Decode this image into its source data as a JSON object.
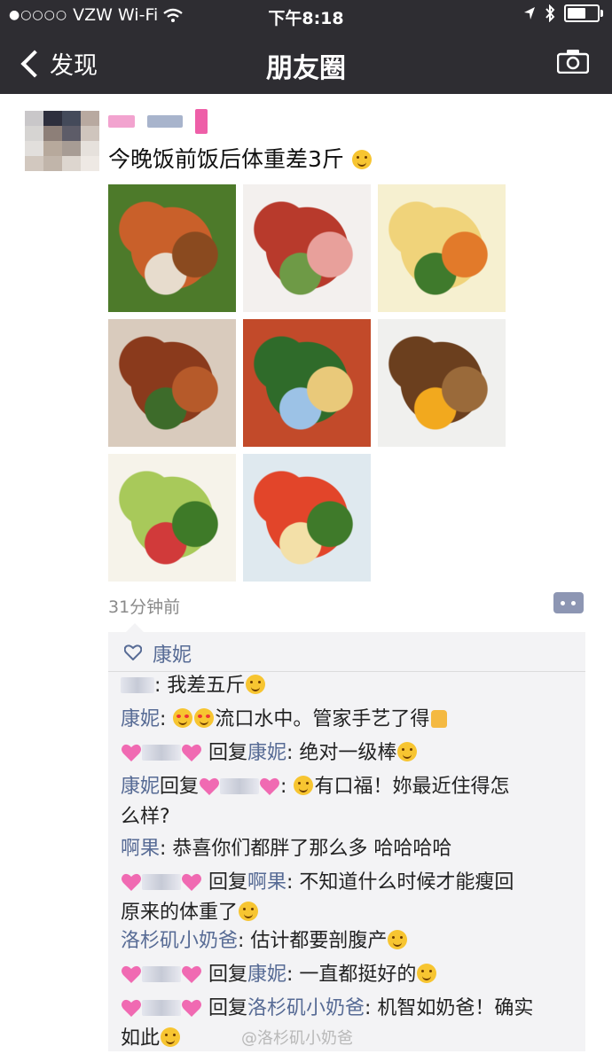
{
  "status_bar": {
    "carrier": "VZW Wi-Fi",
    "time": "下午8:18"
  },
  "nav": {
    "back_label": "发现",
    "title": "朋友圈"
  },
  "post": {
    "text": "今晚饭前饭后体重差3斤",
    "time_ago": "31分钟前",
    "photos": [
      {
        "name": "photo-crab-shrimp",
        "colors": [
          "#c9602a",
          "#8a4a1f",
          "#e7dccd",
          "#4d7a2a"
        ]
      },
      {
        "name": "photo-meat-salad",
        "colors": [
          "#b83a2c",
          "#e8a09b",
          "#6e9a46",
          "#f3f0ee"
        ]
      },
      {
        "name": "photo-corn-salad",
        "colors": [
          "#f0d37a",
          "#e27a2a",
          "#3f7a2c",
          "#f6f0d0"
        ]
      },
      {
        "name": "photo-roast-chicken",
        "colors": [
          "#8a3a1c",
          "#b65a2a",
          "#3d6b2a",
          "#d9cbbd"
        ]
      },
      {
        "name": "photo-shredded-salad",
        "colors": [
          "#2f6b2a",
          "#e9c97a",
          "#9cc2e6",
          "#c24a2a"
        ]
      },
      {
        "name": "photo-fried-rolls",
        "colors": [
          "#6b3f1e",
          "#9a6a3a",
          "#f2a91e",
          "#f0f0ee"
        ]
      },
      {
        "name": "photo-cucumber-salad",
        "colors": [
          "#a8c95a",
          "#3e7a28",
          "#d13a3a",
          "#f6f3ea"
        ]
      },
      {
        "name": "photo-tomato-flower",
        "colors": [
          "#e2452a",
          "#3f7a2a",
          "#f3e0a8",
          "#dfe9ef"
        ]
      }
    ]
  },
  "likes": {
    "names": "康妮"
  },
  "comments": {
    "c1": {
      "text": ": 我差五斤"
    },
    "c2": {
      "user": "康妮",
      "text": ": ",
      "after": "流口水中。管家手艺了得"
    },
    "c3": {
      "reply_word": " 回复",
      "target": "康妮",
      "text": ": 绝对一级棒"
    },
    "c4": {
      "user": "康妮",
      "reply_word": "回复",
      "text": ": ",
      "line1": "有口福！妳最近住得怎",
      "line2": "么样?"
    },
    "c5": {
      "user": "啊果",
      "text": ": 恭喜你们都胖了那么多 哈哈哈哈"
    },
    "c6": {
      "reply_word": " 回复",
      "target": "啊果",
      "line1": ": 不知道什么时候才能瘦回",
      "line2": "原来的体重了"
    },
    "c7": {
      "user": "洛杉矶小奶爸",
      "text": ": 估计都要剖腹产"
    },
    "c8": {
      "reply_word": " 回复",
      "target": "康妮",
      "text": ": 一直都挺好的"
    },
    "c9": {
      "reply_word": " 回复",
      "target": "洛杉矶小奶爸",
      "line1": ": 机智如奶爸！确实",
      "line2": "如此"
    }
  },
  "watermark": "@洛杉矶小奶爸",
  "colors": {
    "bar": "#2e2d32",
    "link": "#576b95",
    "panel": "#f3f3f5"
  }
}
